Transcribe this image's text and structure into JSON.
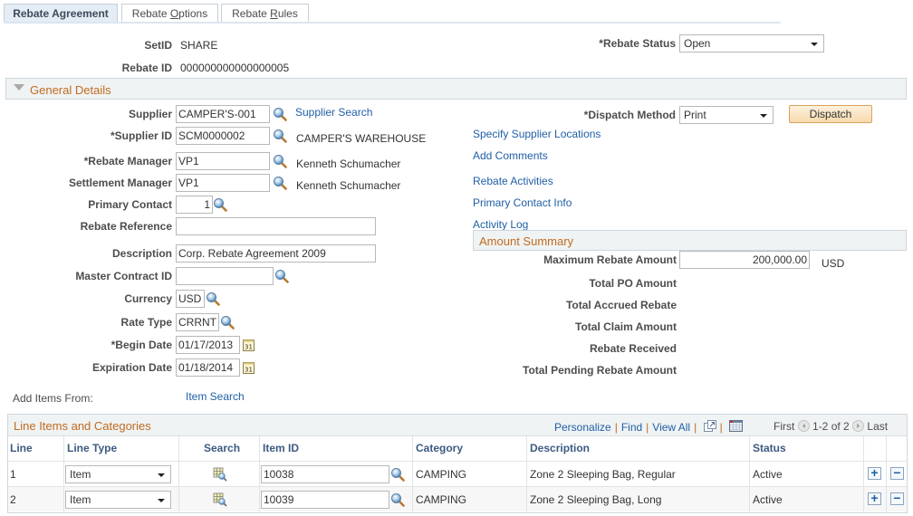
{
  "tabs": [
    {
      "label": "Rebate Agreement",
      "active": true
    },
    {
      "label_pre": "Rebate ",
      "label_ul": "O",
      "label_post": "ptions",
      "active": false
    },
    {
      "label_pre": "Rebate ",
      "label_ul": "R",
      "label_post": "ules",
      "active": false
    }
  ],
  "header": {
    "setid_label": "SetID",
    "setid_value": "SHARE",
    "rebate_id_label": "Rebate ID",
    "rebate_id_value": "000000000000000005",
    "rebate_status_label": "*Rebate Status",
    "rebate_status_value": "Open"
  },
  "general_details": {
    "title": "General Details",
    "supplier_label": "Supplier",
    "supplier_value": "CAMPER'S-001",
    "supplier_search_link": "Supplier Search",
    "supplier_id_label": "*Supplier ID",
    "supplier_id_value": "SCM0000002",
    "supplier_name": "CAMPER'S WAREHOUSE",
    "rebate_manager_label": "*Rebate Manager",
    "rebate_manager_value": "VP1",
    "rebate_manager_name": "Kenneth Schumacher",
    "settlement_manager_label": "Settlement Manager",
    "settlement_manager_value": "VP1",
    "settlement_manager_name": "Kenneth Schumacher",
    "primary_contact_label": "Primary Contact",
    "primary_contact_value": "1",
    "rebate_reference_label": "Rebate Reference",
    "rebate_reference_value": "",
    "description_label": "Description",
    "description_value": "Corp. Rebate Agreement 2009",
    "master_contract_label": "Master Contract ID",
    "master_contract_value": "",
    "currency_label": "Currency",
    "currency_value": "USD",
    "rate_type_label": "Rate Type",
    "rate_type_value": "CRRNT",
    "begin_date_label": "*Begin Date",
    "begin_date_value": "01/17/2013",
    "expiration_date_label": "Expiration Date",
    "expiration_date_value": "01/18/2014",
    "add_items_label": "Add Items From:",
    "item_search_link": "Item Search",
    "dispatch_method_label": "*Dispatch Method",
    "dispatch_method_value": "Print",
    "dispatch_button": "Dispatch",
    "links": {
      "specify_locations": "Specify Supplier Locations",
      "add_comments": "Add Comments",
      "rebate_activities": "Rebate Activities",
      "primary_contact_info": "Primary Contact Info",
      "activity_log": "Activity Log"
    }
  },
  "amount_summary": {
    "title": "Amount Summary",
    "max_rebate_label": "Maximum Rebate Amount",
    "max_rebate_value": "200,000.00",
    "max_rebate_currency": "USD",
    "total_po_label": "Total PO Amount",
    "total_accrued_label": "Total Accrued Rebate",
    "total_claim_label": "Total Claim Amount",
    "rebate_received_label": "Rebate Received",
    "total_pending_label": "Total Pending Rebate Amount"
  },
  "line_items": {
    "title": "Line Items and Categories",
    "nav": {
      "personalize": "Personalize",
      "find": "Find",
      "view_all": "View All",
      "first": "First",
      "range": "1-2 of 2",
      "last": "Last"
    },
    "columns": [
      "Line",
      "Line Type",
      "Search",
      "Item ID",
      "Category",
      "Description",
      "Status"
    ],
    "rows": [
      {
        "line": "1",
        "line_type": "Item",
        "item_id": "10038",
        "category": "CAMPING",
        "description": "Zone 2 Sleeping Bag, Regular",
        "status": "Active"
      },
      {
        "line": "2",
        "line_type": "Item",
        "item_id": "10039",
        "category": "CAMPING",
        "description": "Zone 2 Sleeping Bag, Long",
        "status": "Active"
      }
    ]
  },
  "colors": {
    "link": "#1f5fa6",
    "section_title": "#c06b1f",
    "section_bg": "#f0f3f4",
    "button_bg": "#f7d9ad"
  }
}
